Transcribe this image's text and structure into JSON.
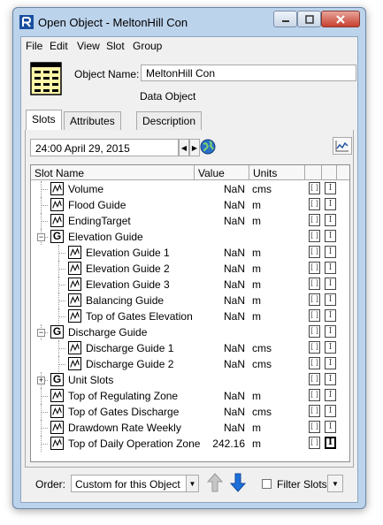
{
  "window": {
    "title": "Open Object - MeltonHill Con",
    "controls": [
      "minimize-icon",
      "maximize-icon",
      "close-icon"
    ]
  },
  "menu": [
    "File",
    "Edit",
    "View",
    "Slot",
    "Group"
  ],
  "object": {
    "name_label": "Object Name:",
    "name_value": "MeltonHill Con",
    "type": "Data Object"
  },
  "tabs": [
    {
      "label": "Slots",
      "active": true
    },
    {
      "label": "Attributes",
      "active": false
    },
    {
      "label": "Description",
      "active": false
    }
  ],
  "timestep": {
    "value": "24:00 April 29, 2015"
  },
  "table": {
    "headers": [
      "Slot Name",
      "Value",
      "Units"
    ],
    "rows": [
      {
        "name": "Volume",
        "value": "NaN",
        "units": "cms",
        "kind": "slot",
        "level": 0,
        "flag_on": false
      },
      {
        "name": "Flood Guide",
        "value": "NaN",
        "units": "m",
        "kind": "slot",
        "level": 0,
        "flag_on": false
      },
      {
        "name": "EndingTarget",
        "value": "NaN",
        "units": "m",
        "kind": "slot",
        "level": 0,
        "flag_on": false
      },
      {
        "name": "Elevation Guide",
        "value": "",
        "units": "",
        "kind": "group",
        "level": 0,
        "expanded": true
      },
      {
        "name": "Elevation Guide 1",
        "value": "NaN",
        "units": "m",
        "kind": "slot",
        "level": 1,
        "flag_on": false
      },
      {
        "name": "Elevation Guide 2",
        "value": "NaN",
        "units": "m",
        "kind": "slot",
        "level": 1,
        "flag_on": false
      },
      {
        "name": "Elevation Guide 3",
        "value": "NaN",
        "units": "m",
        "kind": "slot",
        "level": 1,
        "flag_on": false
      },
      {
        "name": "Balancing Guide",
        "value": "NaN",
        "units": "m",
        "kind": "slot",
        "level": 1,
        "flag_on": false
      },
      {
        "name": "Top of Gates Elevation",
        "value": "NaN",
        "units": "m",
        "kind": "slot",
        "level": 1,
        "flag_on": false
      },
      {
        "name": "Discharge Guide",
        "value": "",
        "units": "",
        "kind": "group",
        "level": 0,
        "expanded": true
      },
      {
        "name": "Discharge Guide 1",
        "value": "NaN",
        "units": "cms",
        "kind": "slot",
        "level": 1,
        "flag_on": false
      },
      {
        "name": "Discharge Guide 2",
        "value": "NaN",
        "units": "cms",
        "kind": "slot",
        "level": 1,
        "flag_on": false
      },
      {
        "name": "Unit Slots",
        "value": "",
        "units": "",
        "kind": "group",
        "level": 0,
        "expanded": false
      },
      {
        "name": "Top of Regulating Zone",
        "value": "NaN",
        "units": "m",
        "kind": "slot",
        "level": 0,
        "flag_on": false
      },
      {
        "name": "Top of Gates Discharge",
        "value": "NaN",
        "units": "cms",
        "kind": "slot",
        "level": 0,
        "flag_on": false
      },
      {
        "name": "Drawdown Rate Weekly",
        "value": "NaN",
        "units": "m",
        "kind": "slot",
        "level": 0,
        "flag_on": false
      },
      {
        "name": "Top of Daily Operation Zone",
        "value": "242.16",
        "units": "m",
        "kind": "slot",
        "level": 0,
        "flag_on": true
      }
    ]
  },
  "bottom": {
    "order_label": "Order:",
    "order_value": "Custom for this Object",
    "filter_label": "Filter Slots"
  },
  "colors": {
    "frame": "#bcd3ec",
    "panel": "#f0f0f0",
    "close_button": "#c7402f",
    "arrow_blue": "#1e6fd9"
  }
}
